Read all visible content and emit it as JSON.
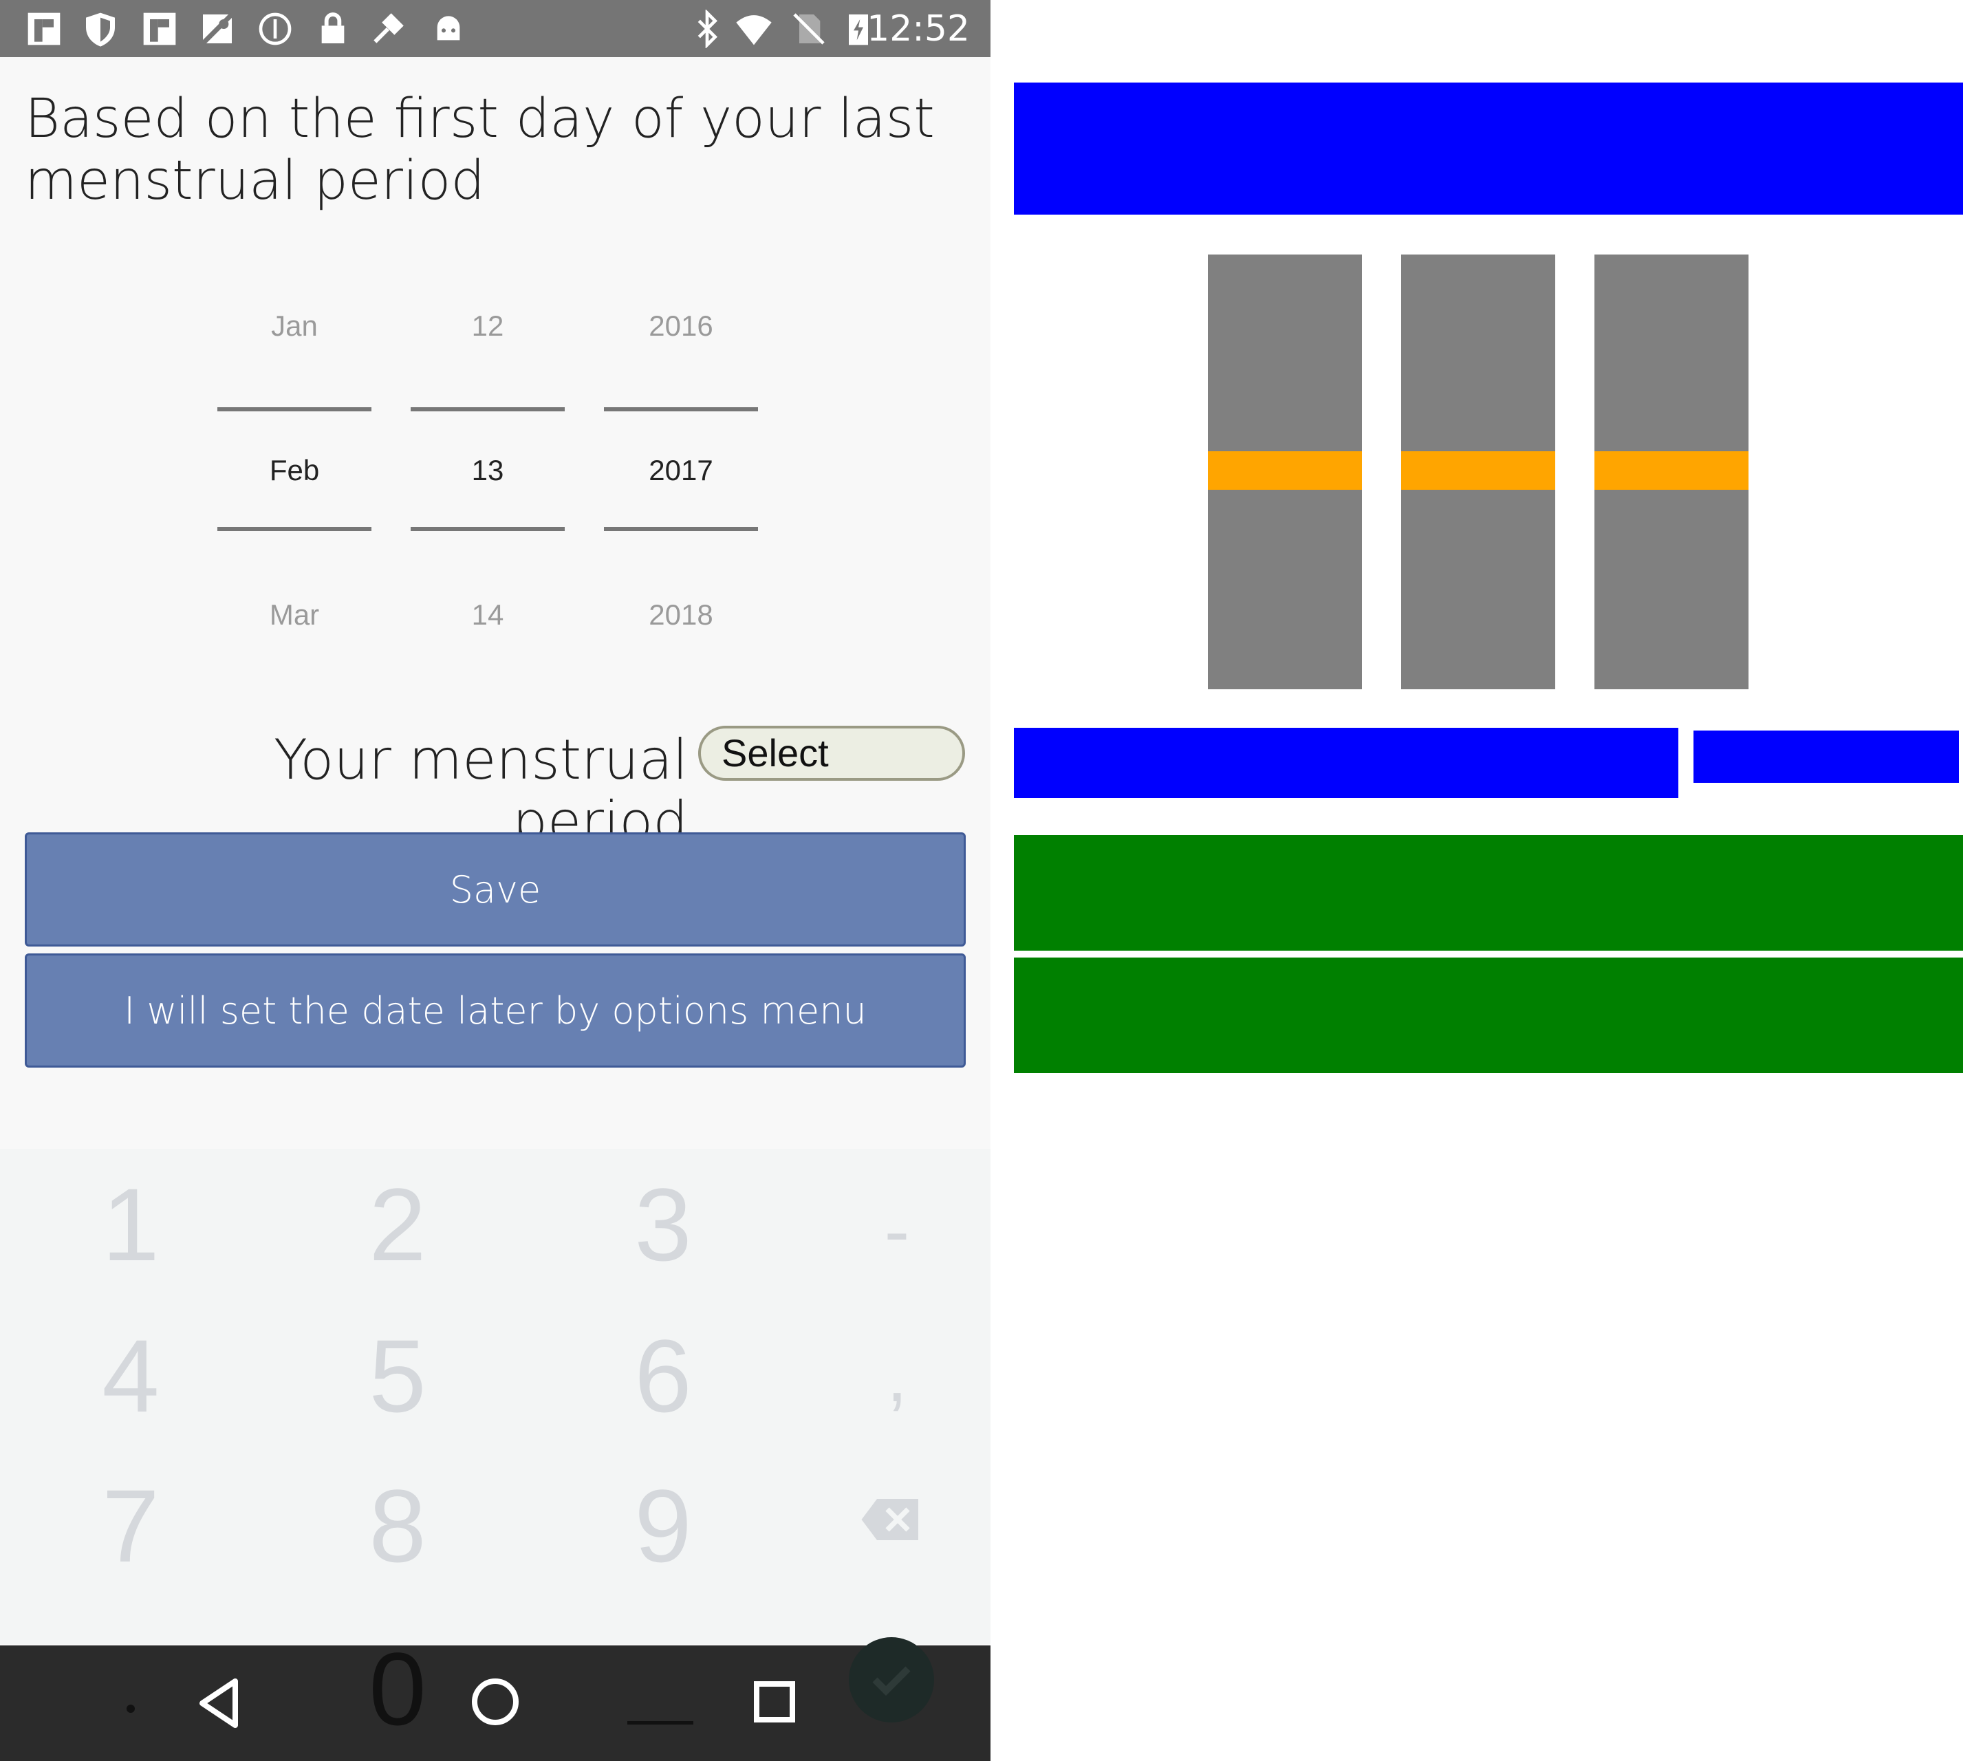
{
  "status_bar": {
    "time": "12:52",
    "left_icons": [
      "flipboard-icon",
      "shield-icon",
      "flipboard-icon",
      "maps-icon",
      "vpn-icon",
      "lock-icon",
      "fake-gps-icon",
      "android-icon"
    ],
    "right_icons": [
      "bluetooth-icon",
      "wifi-icon",
      "no-sim-icon",
      "battery-charging-icon"
    ]
  },
  "screen": {
    "title": "Based on the first day of your last menstrual period",
    "date_picker": {
      "month": {
        "prev": "Jan",
        "selected": "Feb",
        "next": "Mar"
      },
      "day": {
        "prev": "12",
        "selected": "13",
        "next": "14"
      },
      "year": {
        "prev": "2016",
        "selected": "2017",
        "next": "2018"
      }
    },
    "period_label": "Your menstrual period",
    "select_label": "Select",
    "save_label": "Save",
    "later_label": "I will set the date later by options menu"
  },
  "keypad": {
    "keys": [
      "1",
      "2",
      "3",
      "-",
      "4",
      "5",
      "6",
      ",",
      "7",
      "8",
      "9",
      "0"
    ],
    "backspace_icon": "backspace-icon",
    "done_icon": "check-icon"
  },
  "navigation": {
    "icons": [
      "back-icon",
      "home-icon",
      "recents-icon"
    ]
  },
  "colors": {
    "button_bg": "#6780b2",
    "overlay_blue": "#0000ff",
    "overlay_gray": "#808080",
    "overlay_orange": "#ffa500",
    "overlay_green": "#008000"
  }
}
